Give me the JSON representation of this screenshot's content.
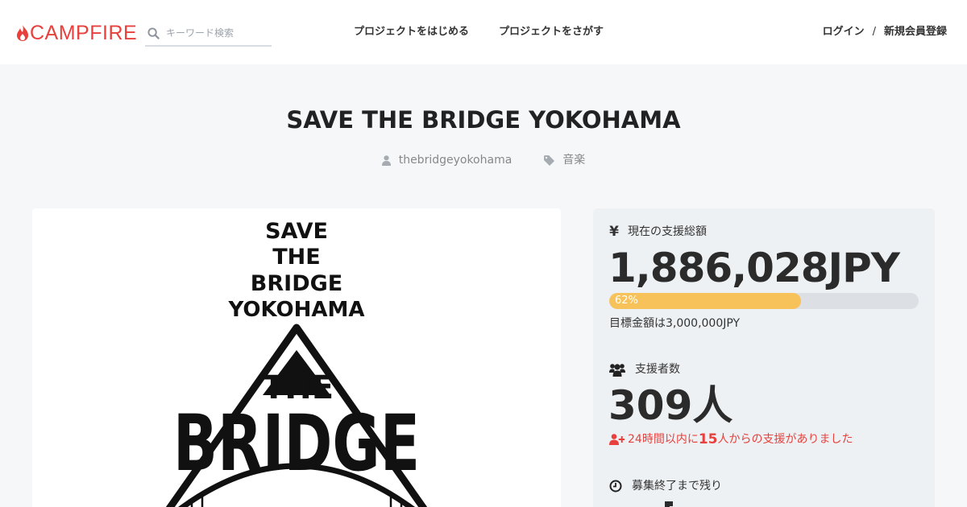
{
  "header": {
    "logo": "CAMPFIRE",
    "search_placeholder": "キーワード検索",
    "nav_start": "プロジェクトをはじめる",
    "nav_find": "プロジェクトをさがす",
    "login": "ログイン",
    "separator": "/",
    "signup": "新規会員登録"
  },
  "project": {
    "title": "SAVE THE BRIDGE YOKOHAMA",
    "owner": "thebridgeyokohama",
    "category": "音楽",
    "image_text": {
      "line1": "SAVE",
      "line2": "THE",
      "line3": "BRIDGE",
      "line4": "YOKOHAMA",
      "logo_the": "THE",
      "logo_bridge": "BRIDGE"
    }
  },
  "stats": {
    "funding_label": "現在の支援総額",
    "amount": "1,886,028JPY",
    "progress_percent": 62,
    "progress_label": "62%",
    "goal": "目標金額は3,000,000JPY",
    "supporters_label": "支援者数",
    "supporters": "309人",
    "recent_prefix": "24時間以内に",
    "recent_count": "15",
    "recent_suffix": "人からの支援がありました",
    "remaining_label": "募集終了まで残り"
  },
  "colors": {
    "brand": "#e8413d",
    "progress": "#f7c25a",
    "panel": "#eef1f4"
  },
  "icons": {
    "yen": "¥"
  }
}
